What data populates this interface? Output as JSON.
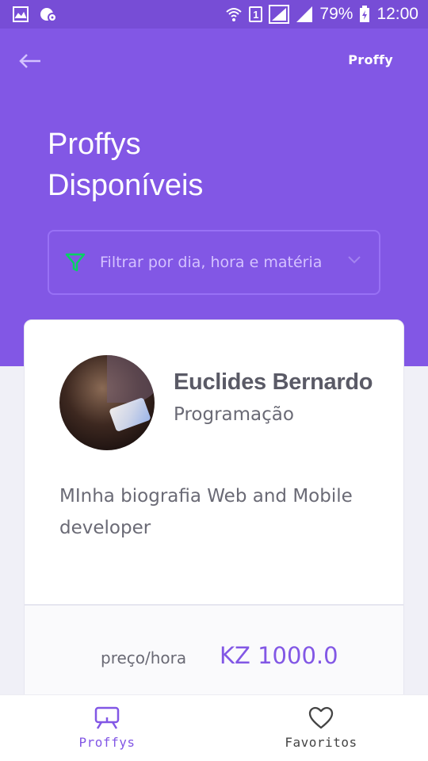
{
  "statusbar": {
    "battery": "79%",
    "time": "12:00",
    "sim": "1"
  },
  "header": {
    "brand": "Proffy",
    "title_line1": "Proffys",
    "title_line2": "Disponíveis"
  },
  "filter": {
    "label": "Filtrar por dia, hora e matéria"
  },
  "teacher": {
    "name": "Euclides Bernardo",
    "subject": "Programação",
    "bio": "MInha biografia Web and Mobile developer",
    "price_label": "preço/hora",
    "price_value": "KZ 1000.0"
  },
  "tabs": [
    {
      "label": "Proffys",
      "active": true
    },
    {
      "label": "Favoritos",
      "active": false
    }
  ],
  "colors": {
    "primary": "#8257e5",
    "statusbar": "#774dd6",
    "filter_icon": "#04d361"
  }
}
